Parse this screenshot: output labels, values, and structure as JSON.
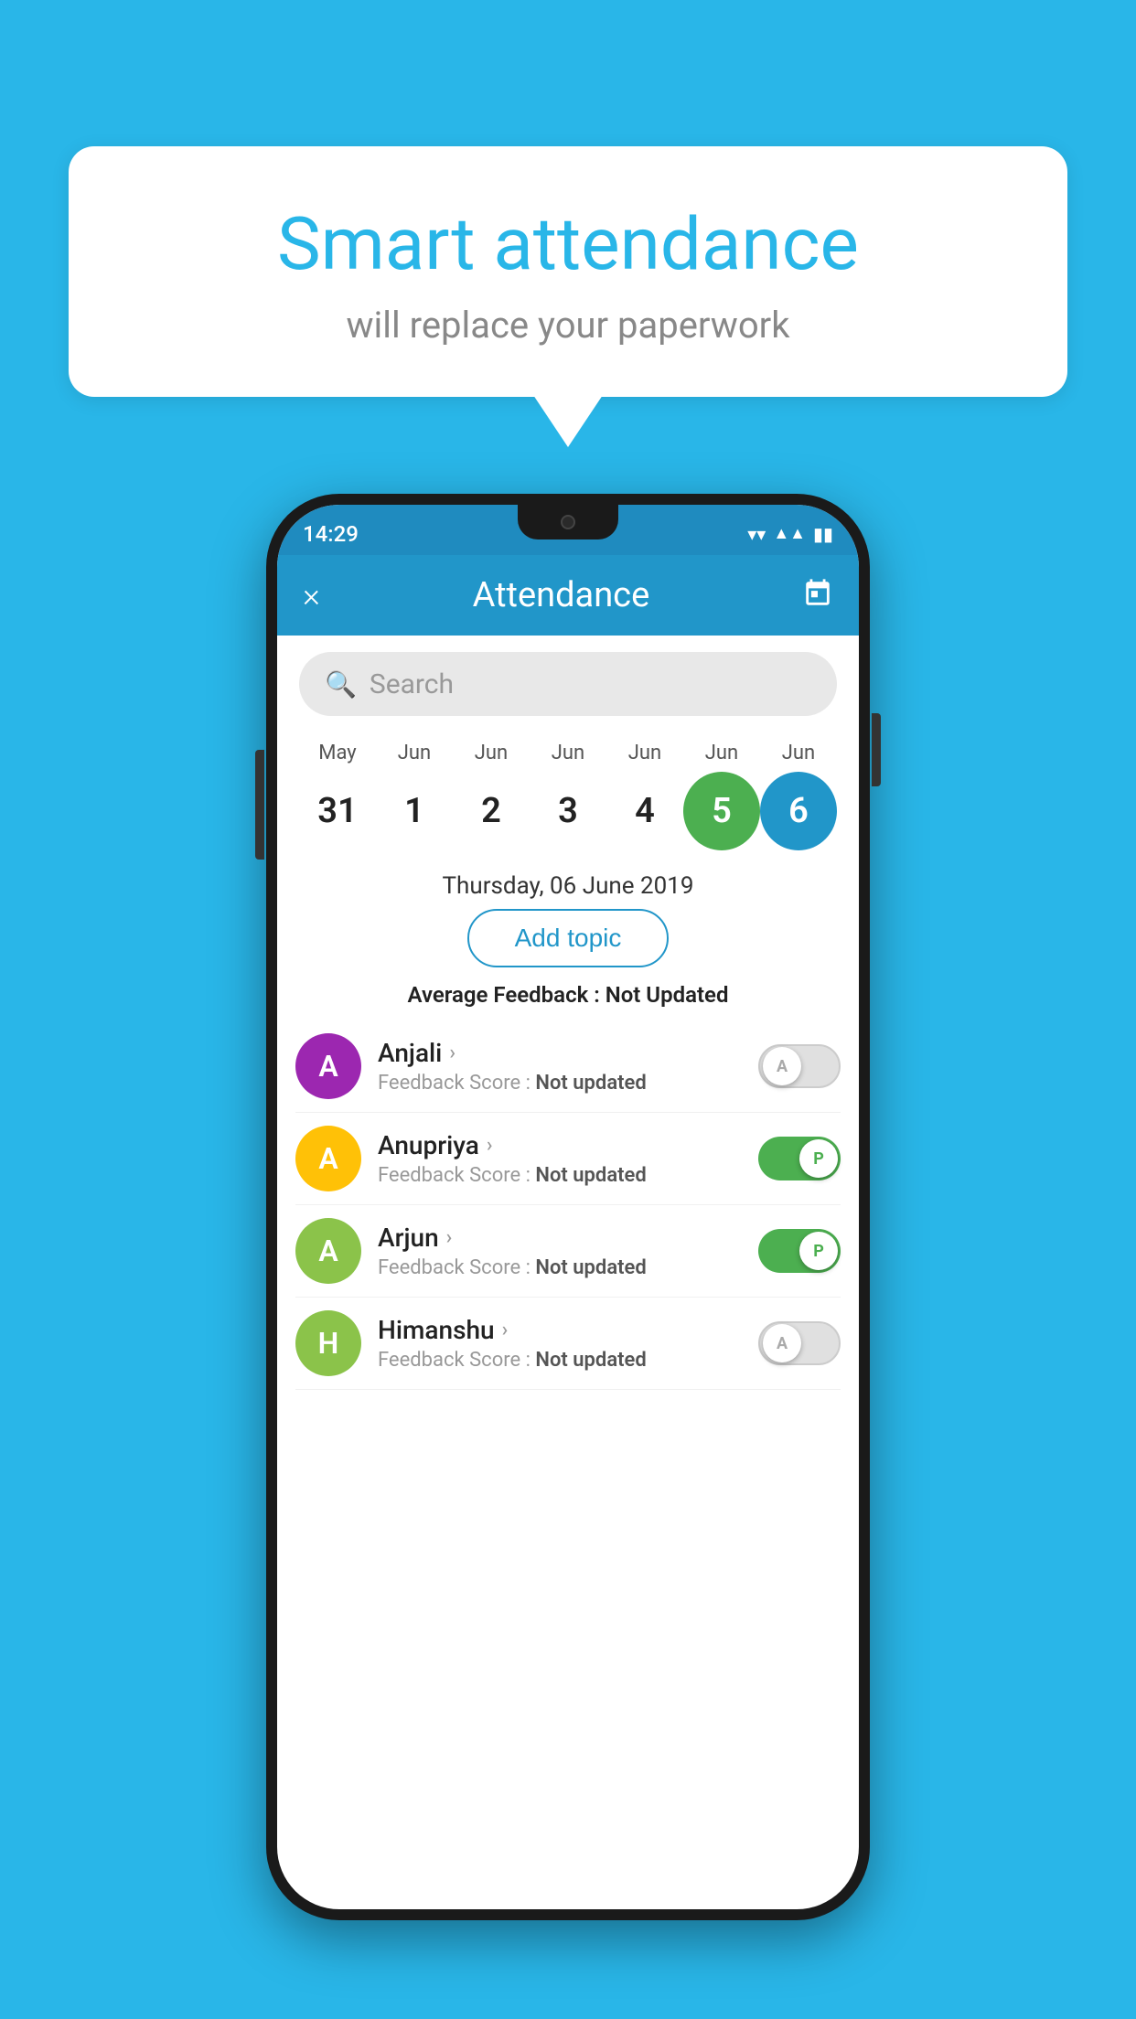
{
  "background_color": "#29b6e8",
  "speech_bubble": {
    "title": "Smart attendance",
    "subtitle": "will replace your paperwork"
  },
  "status_bar": {
    "time": "14:29",
    "icons": [
      "wifi",
      "signal",
      "battery"
    ]
  },
  "app_header": {
    "title": "Attendance",
    "close_label": "×",
    "calendar_label": "📅"
  },
  "search": {
    "placeholder": "Search"
  },
  "calendar": {
    "months": [
      "May",
      "Jun",
      "Jun",
      "Jun",
      "Jun",
      "Jun",
      "Jun"
    ],
    "dates": [
      "31",
      "1",
      "2",
      "3",
      "4",
      "5",
      "6"
    ],
    "active_green": 5,
    "active_blue": 6,
    "selected_date": "Thursday, 06 June 2019"
  },
  "add_topic_button": "Add topic",
  "average_feedback": {
    "label": "Average Feedback : ",
    "value": "Not Updated"
  },
  "students": [
    {
      "name": "Anjali",
      "avatar_letter": "A",
      "avatar_color": "#9c27b0",
      "feedback": "Feedback Score : Not updated",
      "toggle_state": "off",
      "toggle_label": "A"
    },
    {
      "name": "Anupriya",
      "avatar_letter": "A",
      "avatar_color": "#ffc107",
      "feedback": "Feedback Score : Not updated",
      "toggle_state": "on",
      "toggle_label": "P"
    },
    {
      "name": "Arjun",
      "avatar_letter": "A",
      "avatar_color": "#8bc34a",
      "feedback": "Feedback Score : Not updated",
      "toggle_state": "on",
      "toggle_label": "P"
    },
    {
      "name": "Himanshu",
      "avatar_letter": "H",
      "avatar_color": "#8bc34a",
      "feedback": "Feedback Score : Not updated",
      "toggle_state": "off",
      "toggle_label": "A"
    }
  ]
}
